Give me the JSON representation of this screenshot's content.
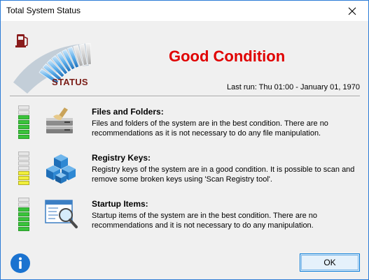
{
  "window": {
    "title": "Total System Status",
    "close_icon": "close-icon"
  },
  "header": {
    "gauge_icon": "fuel-pump-icon",
    "status_label": "STATUS",
    "condition": "Good Condition",
    "condition_color": "#e00000",
    "last_run": "Last run: Thu 01:00 - January 01, 1970"
  },
  "items": [
    {
      "title": "Files and Folders:",
      "description": "Files and folders of the system are in the best condition. There are no recommendations as it is not necessary to do any file manipulation.",
      "icon": "disk-cleanup-icon",
      "meter_filled": 5,
      "meter_total": 7,
      "meter_color": "green"
    },
    {
      "title": "Registry Keys:",
      "description": "Registry keys of the system are in a good condition. It is possible to scan and remove some broken keys using 'Scan Registry tool'.",
      "icon": "registry-cubes-icon",
      "meter_filled": 3,
      "meter_total": 7,
      "meter_color": "yellow"
    },
    {
      "title": "Startup Items:",
      "description": "Startup items of the system are in the best condition. There are no recommendations and it is not necessary to do any manipulation.",
      "icon": "startup-window-magnifier-icon",
      "meter_filled": 5,
      "meter_total": 7,
      "meter_color": "green"
    }
  ],
  "footer": {
    "info_icon": "info-icon",
    "ok_label": "OK"
  },
  "colors": {
    "accent": "#0078d7",
    "meter_green": "#39c33a",
    "meter_yellow": "#f1ef3a",
    "status_label": "#7b1d17"
  }
}
